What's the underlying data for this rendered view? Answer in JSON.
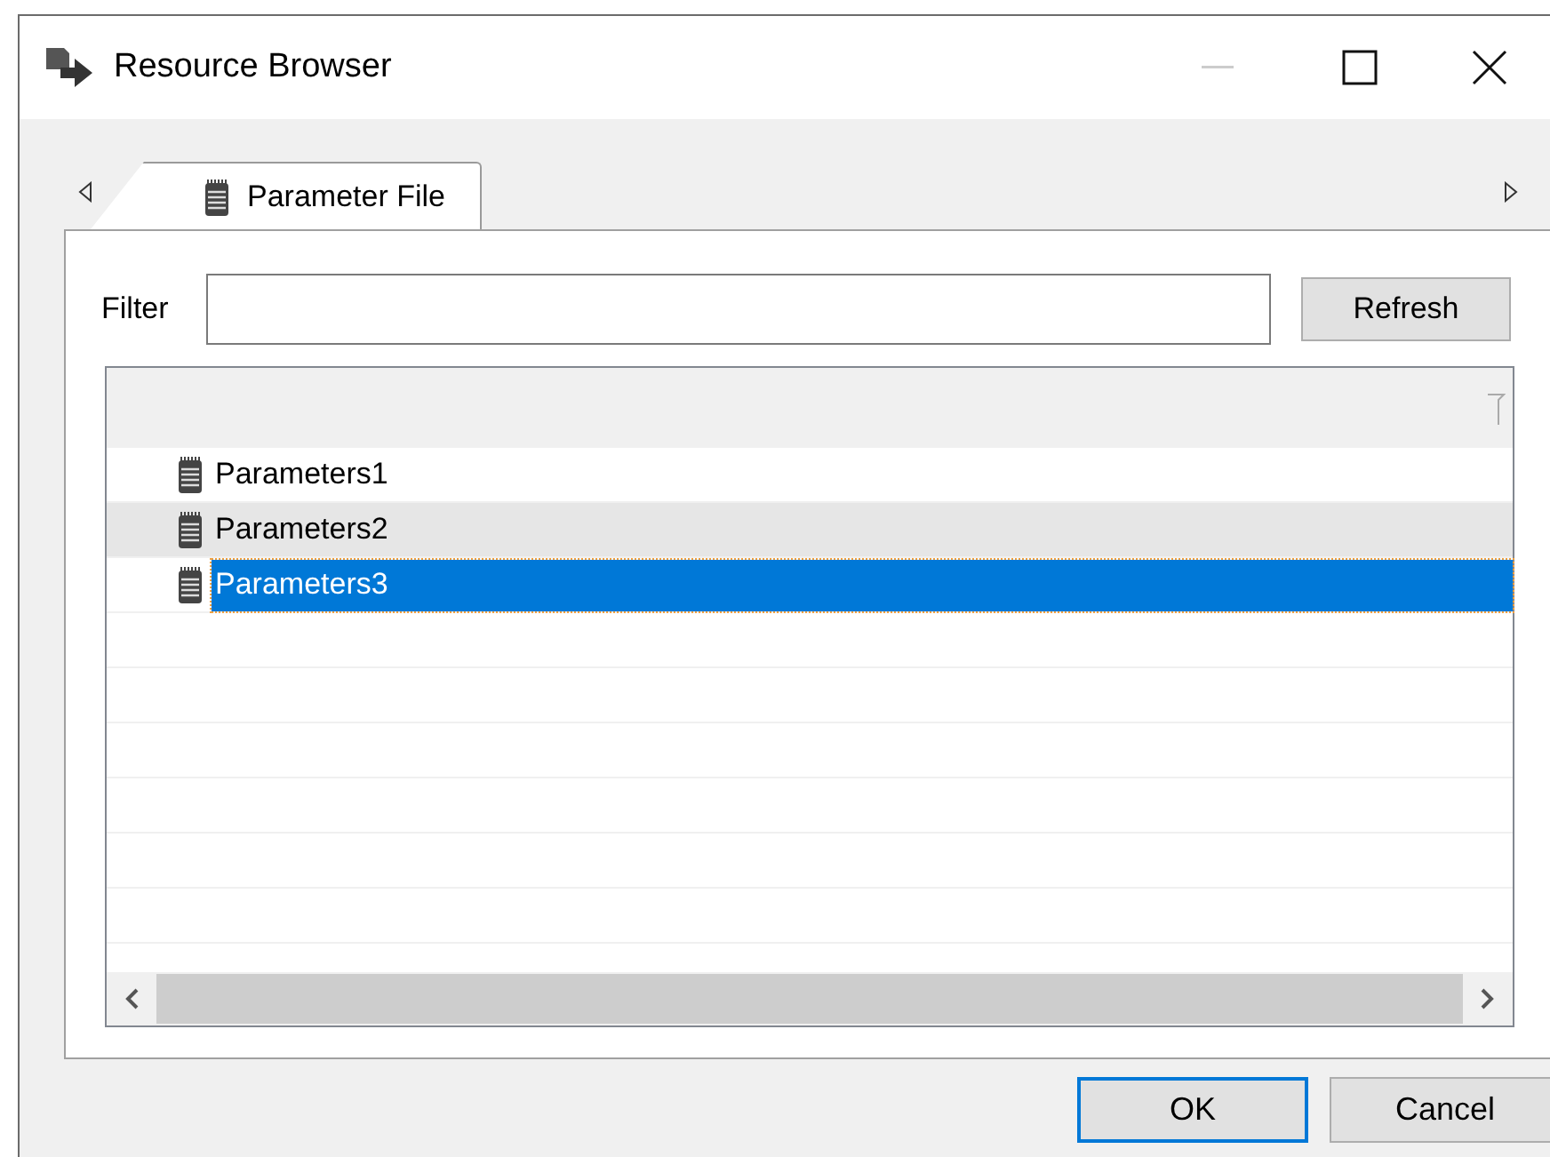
{
  "window": {
    "title": "Resource Browser"
  },
  "tabs": [
    {
      "label": "Parameter File",
      "selected": true
    }
  ],
  "filter": {
    "label": "Filter"
  },
  "refresh_button": "Refresh",
  "list": {
    "rows": [
      {
        "name": "Parameters1",
        "selected": false,
        "hovered": false
      },
      {
        "name": "Parameters2",
        "selected": false,
        "hovered": true
      },
      {
        "name": "Parameters3",
        "selected": true,
        "hovered": false
      }
    ]
  },
  "buttons": [
    {
      "label": "OK",
      "default": true
    },
    {
      "label": "Cancel",
      "default": false
    }
  ]
}
